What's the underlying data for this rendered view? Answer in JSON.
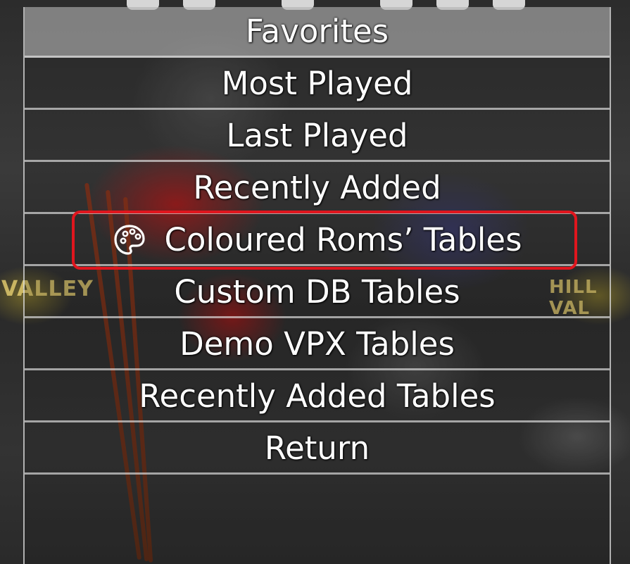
{
  "menu": {
    "items": [
      {
        "label": "Favorites",
        "icon": null,
        "selected": true
      },
      {
        "label": "Most Played",
        "icon": null,
        "selected": false
      },
      {
        "label": "Last Played",
        "icon": null,
        "selected": false
      },
      {
        "label": "Recently Added",
        "icon": null,
        "selected": false
      },
      {
        "label": "Coloured Roms’ Tables",
        "icon": "palette-icon",
        "selected": false
      },
      {
        "label": "Custom DB Tables",
        "icon": null,
        "selected": false
      },
      {
        "label": "Demo VPX Tables",
        "icon": null,
        "selected": false
      },
      {
        "label": "Recently Added Tables",
        "icon": null,
        "selected": false
      },
      {
        "label": "Return",
        "icon": null,
        "selected": false
      }
    ]
  },
  "backdrop": {
    "left_sign": "VALLEY",
    "right_sign": "HILL VAL"
  },
  "colors": {
    "annotation_box": "#e0161e",
    "text": "#ffffff",
    "selected_row": "#c8c8c8"
  }
}
